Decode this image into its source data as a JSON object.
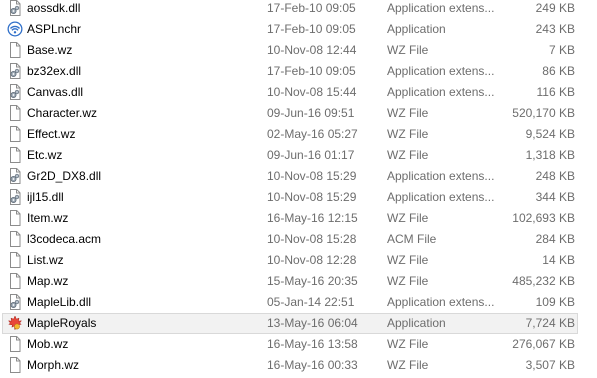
{
  "files": [
    {
      "name": "aossdk.dll",
      "date": "17-Feb-10 09:05",
      "type": "Application extens...",
      "size": "249 KB",
      "icon": "dll-file-icon"
    },
    {
      "name": "ASPLnchr",
      "date": "17-Feb-10 09:05",
      "type": "Application",
      "size": "243 KB",
      "icon": "wifi-app-icon"
    },
    {
      "name": "Base.wz",
      "date": "10-Nov-08 12:44",
      "type": "WZ File",
      "size": "7 KB",
      "icon": "blank-file-icon"
    },
    {
      "name": "bz32ex.dll",
      "date": "17-Feb-10 09:05",
      "type": "Application extens...",
      "size": "86 KB",
      "icon": "dll-file-icon"
    },
    {
      "name": "Canvas.dll",
      "date": "10-Nov-08 15:44",
      "type": "Application extens...",
      "size": "116 KB",
      "icon": "dll-file-icon"
    },
    {
      "name": "Character.wz",
      "date": "09-Jun-16 09:51",
      "type": "WZ File",
      "size": "520,170 KB",
      "icon": "blank-file-icon"
    },
    {
      "name": "Effect.wz",
      "date": "02-May-16 05:27",
      "type": "WZ File",
      "size": "9,524 KB",
      "icon": "blank-file-icon"
    },
    {
      "name": "Etc.wz",
      "date": "09-Jun-16 01:17",
      "type": "WZ File",
      "size": "1,318 KB",
      "icon": "blank-file-icon"
    },
    {
      "name": "Gr2D_DX8.dll",
      "date": "10-Nov-08 15:29",
      "type": "Application extens...",
      "size": "248 KB",
      "icon": "dll-file-icon"
    },
    {
      "name": "ijl15.dll",
      "date": "10-Nov-08 15:29",
      "type": "Application extens...",
      "size": "344 KB",
      "icon": "dll-file-icon"
    },
    {
      "name": "Item.wz",
      "date": "16-May-16 12:15",
      "type": "WZ File",
      "size": "102,693 KB",
      "icon": "blank-file-icon"
    },
    {
      "name": "l3codeca.acm",
      "date": "10-Nov-08 15:28",
      "type": "ACM File",
      "size": "284 KB",
      "icon": "blank-file-icon"
    },
    {
      "name": "List.wz",
      "date": "10-Nov-08 12:28",
      "type": "WZ File",
      "size": "14 KB",
      "icon": "blank-file-icon"
    },
    {
      "name": "Map.wz",
      "date": "15-May-16 20:35",
      "type": "WZ File",
      "size": "485,232 KB",
      "icon": "blank-file-icon"
    },
    {
      "name": "MapleLib.dll",
      "date": "05-Jan-14 22:51",
      "type": "Application extens...",
      "size": "109 KB",
      "icon": "dll-file-icon"
    },
    {
      "name": "MapleRoyals",
      "date": "13-May-16 06:04",
      "type": "Application",
      "size": "7,724 KB",
      "icon": "maple-leaf-app-icon",
      "selected": true
    },
    {
      "name": "Mob.wz",
      "date": "16-May-16 13:58",
      "type": "WZ File",
      "size": "276,067 KB",
      "icon": "blank-file-icon"
    },
    {
      "name": "Morph.wz",
      "date": "16-May-16 00:33",
      "type": "WZ File",
      "size": "3,507 KB",
      "icon": "blank-file-icon"
    }
  ],
  "colors": {
    "meta_text": "#6d6d6d",
    "selected_bg": "#f2f2f2",
    "selected_border": "#d9d9d9"
  }
}
